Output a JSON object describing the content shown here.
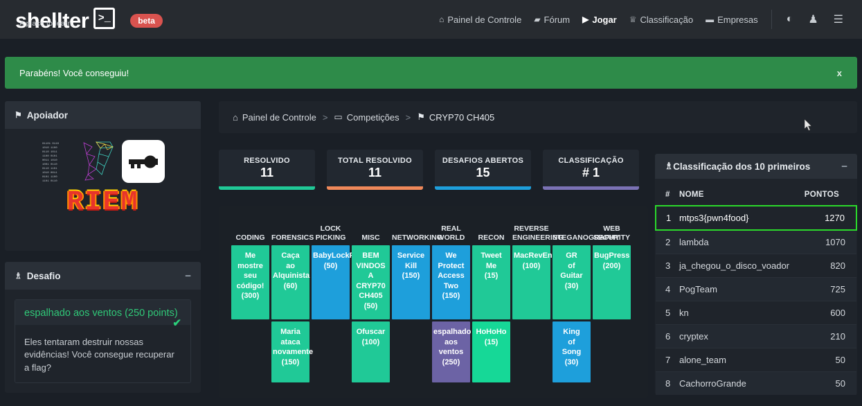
{
  "brand": {
    "name": "shellter",
    "tagline": "A place to learn.",
    "terminal_glyph": ">_",
    "badge": "beta"
  },
  "nav": {
    "items": [
      {
        "label": "Painel de Controle",
        "icon": "home-icon",
        "glyph": "⌂",
        "active": false
      },
      {
        "label": "Fórum",
        "icon": "folder-icon",
        "glyph": "▰",
        "active": false
      },
      {
        "label": "Jogar",
        "icon": "play-icon",
        "glyph": "▶",
        "active": true
      },
      {
        "label": "Classificação",
        "icon": "trophy-icon",
        "glyph": "♕",
        "active": false
      },
      {
        "label": "Empresas",
        "icon": "briefcase-icon",
        "glyph": "▬",
        "active": false
      }
    ],
    "icons": [
      {
        "name": "globe-icon",
        "glyph": "◐"
      },
      {
        "name": "user-icon",
        "glyph": "♟"
      },
      {
        "name": "hamburger-menu-icon",
        "glyph": "☰"
      }
    ]
  },
  "alert": {
    "message": "Parabéns! Você conseguiu!",
    "close_label": "x",
    "color": "#2e8b49"
  },
  "sidebar": {
    "sponsor_panel": {
      "title": "Apoiador",
      "icon": "flag-icon",
      "art_primary": "CRI7",
      "art_secondary": "RIEM",
      "art_icon": "key-icon"
    },
    "challenge_panel": {
      "title": "Desafio",
      "icon": "trophy-icon",
      "minimize_label": "−",
      "challenge_title": "espalhado aos ventos (250 points)",
      "solved_mark": "✔",
      "description": "Eles tentaram destruir nossas evidências! Você consegue recuperar a flag?"
    }
  },
  "breadcrumb": {
    "items": [
      {
        "label": "Painel de Controle",
        "icon": "home-icon",
        "glyph": "⌂"
      },
      {
        "label": "Competições",
        "icon": "monitor-icon",
        "glyph": "▭"
      },
      {
        "label": "CRYP70 CH405",
        "icon": "flag-icon",
        "glyph": "⚑"
      }
    ],
    "separator": ">"
  },
  "stats": [
    {
      "label": "RESOLVIDO",
      "value": "11",
      "color": "#20c997"
    },
    {
      "label": "TOTAL RESOLVIDO",
      "value": "11",
      "color": "#f0895a"
    },
    {
      "label": "DESAFIOS ABERTOS",
      "value": "15",
      "color": "#1e9fdb"
    },
    {
      "label": "CLASSIFICAÇÃO",
      "value": "# 1",
      "color": "#7b72b5"
    }
  ],
  "categories": [
    {
      "line1": "",
      "line2": "CODING"
    },
    {
      "line1": "",
      "line2": "FORENSICS"
    },
    {
      "line1": "LOCK",
      "line2": "PICKING"
    },
    {
      "line1": "",
      "line2": "MISC"
    },
    {
      "line1": "",
      "line2": "NETWORKING"
    },
    {
      "line1": "REAL",
      "line2": "WORLD"
    },
    {
      "line1": "",
      "line2": "RECON"
    },
    {
      "line1": "REVERSE",
      "line2": "ENGINEERING"
    },
    {
      "line1": "",
      "line2": "STEGANOGRAPHY"
    },
    {
      "line1": "WEB",
      "line2": "SECURITY"
    }
  ],
  "challenge_columns": [
    {
      "category": "CODING",
      "tiles": [
        {
          "lines": [
            "Me",
            "mostre",
            "seu",
            "código!",
            "(300)"
          ],
          "color": "#20c997",
          "height": 107
        }
      ]
    },
    {
      "category": "FORENSICS",
      "tiles": [
        {
          "lines": [
            "Caça",
            "ao",
            "Alquinista",
            "(60)"
          ],
          "color": "#20c997",
          "height": 107
        },
        {
          "lines": [
            "Maria",
            "ataca",
            "novamente",
            "(150)"
          ],
          "color": "#20c997",
          "height": 88
        }
      ]
    },
    {
      "category": "LOCK PICKING",
      "tiles": [
        {
          "lines": [
            "BabyLockPick",
            "(50)"
          ],
          "color": "#1e9fdb",
          "height": 107
        }
      ]
    },
    {
      "category": "MISC",
      "tiles": [
        {
          "lines": [
            "BEM",
            "VINDOS",
            "A",
            "CRYP70",
            "CH405",
            "(50)"
          ],
          "color": "#20c997",
          "height": 107
        },
        {
          "lines": [
            "Ofuscar",
            "(100)"
          ],
          "color": "#20c997",
          "height": 88
        }
      ]
    },
    {
      "category": "NETWORKING",
      "tiles": [
        {
          "lines": [
            "Service",
            "Kill",
            "(150)"
          ],
          "color": "#1e9fdb",
          "height": 107
        }
      ]
    },
    {
      "category": "REAL WORLD",
      "tiles": [
        {
          "lines": [
            "We",
            "Protect",
            "Access",
            "Two",
            "(150)"
          ],
          "color": "#1e9fdb",
          "height": 107
        },
        {
          "lines": [
            "espalhado",
            "aos",
            "ventos",
            "(250)"
          ],
          "color": "#6c63a5",
          "height": 88
        }
      ]
    },
    {
      "category": "RECON",
      "tiles": [
        {
          "lines": [
            "Tweet",
            "Me",
            "(15)"
          ],
          "color": "#20c997",
          "height": 107
        },
        {
          "lines": [
            "HoHoHo",
            "(15)"
          ],
          "color": "#16d897",
          "height": 88
        }
      ]
    },
    {
      "category": "REVERSE ENGINEERING",
      "tiles": [
        {
          "lines": [
            "MacRevEng",
            "(100)"
          ],
          "color": "#20c997",
          "height": 107
        }
      ]
    },
    {
      "category": "STEGANOGRAPHY",
      "tiles": [
        {
          "lines": [
            "GR",
            "of",
            "Guitar",
            "(30)"
          ],
          "color": "#20c997",
          "height": 107
        },
        {
          "lines": [
            "King",
            "of",
            "Song",
            "(30)"
          ],
          "color": "#1e9fdb",
          "height": 88
        }
      ]
    },
    {
      "category": "WEB SECURITY",
      "tiles": [
        {
          "lines": [
            "BugPress",
            "(200)"
          ],
          "color": "#20c997",
          "height": 107
        }
      ]
    }
  ],
  "scoreboard": {
    "title": "Classificação dos 10 primeiros",
    "icon": "trophy-icon",
    "minimize_label": "−",
    "columns": {
      "rank": "#",
      "name": "NOME",
      "points": "PONTOS"
    },
    "highlight_color": "#2bd92b",
    "rows": [
      {
        "rank": "1",
        "name": "mtps3{pwn4food}",
        "points": "1270",
        "highlighted": true
      },
      {
        "rank": "2",
        "name": "lambda",
        "points": "1070",
        "highlighted": false
      },
      {
        "rank": "3",
        "name": "ja_chegou_o_disco_voador",
        "points": "820",
        "highlighted": false
      },
      {
        "rank": "4",
        "name": "PogTeam",
        "points": "725",
        "highlighted": false
      },
      {
        "rank": "5",
        "name": "kn",
        "points": "600",
        "highlighted": false
      },
      {
        "rank": "6",
        "name": "cryptex",
        "points": "210",
        "highlighted": false
      },
      {
        "rank": "7",
        "name": "alone_team",
        "points": "50",
        "highlighted": false
      },
      {
        "rank": "8",
        "name": "CachorroGrande",
        "points": "50",
        "highlighted": false
      }
    ]
  }
}
